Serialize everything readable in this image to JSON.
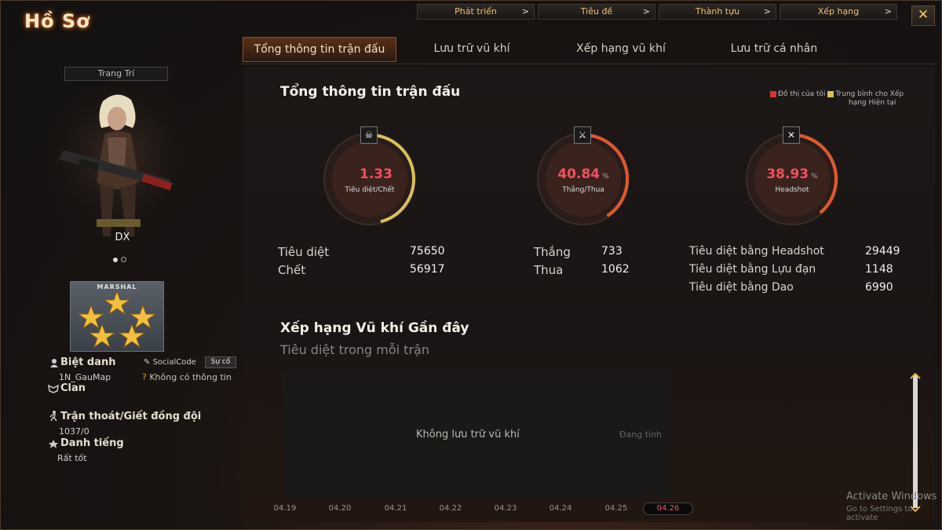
{
  "window": {
    "title": "Hồ Sơ",
    "close_icon": "close-icon"
  },
  "top_nav": [
    {
      "label": "Phát triển"
    },
    {
      "label": "Tiêu đề"
    },
    {
      "label": "Thành tựu"
    },
    {
      "label": "Xếp hạng"
    }
  ],
  "tabs": [
    {
      "label": "Tổng thông tin trận đấu",
      "active": true
    },
    {
      "label": "Lưu trữ vũ khí"
    },
    {
      "label": "Xếp hạng vũ khí"
    },
    {
      "label": "Lưu trữ cá nhân"
    }
  ],
  "profile": {
    "decoration_label": "Trang Trí",
    "character_name": "DX",
    "rank_title": "MARSHAL",
    "rank_stars": 5,
    "nickname_label": "Biệt danh",
    "nickname": "1N_GauMap",
    "socialcode_label": "SocialCode",
    "support_button": "Sự cố",
    "no_info": "Không có thông tin",
    "clan_label": "Clan",
    "escape_label": "Trận thoát/Giết đồng đội",
    "escape_value": "1037/0",
    "reputation_label": "Danh tiếng",
    "reputation_value": "Rất tốt"
  },
  "summary": {
    "title": "Tổng thông tin trận đấu",
    "legend_mine": "Đồ thị của tôi",
    "legend_avg_1": "Trung bình cho Xếp",
    "legend_avg_2": "hạng Hiện tại",
    "colors": {
      "mine": "#d03838",
      "avg": "#d8c060",
      "value": "#f25060"
    },
    "gauges": [
      {
        "value": "1.33",
        "unit": "",
        "label": "Tiêu diệt/Chết",
        "fill": 0.46,
        "icon": "skull-icon"
      },
      {
        "value": "40.84",
        "unit": "%",
        "label": "Thắng/Thua",
        "fill": 0.4084,
        "icon": "crossed-rifles-icon"
      },
      {
        "value": "38.93",
        "unit": "%",
        "label": "Headshot",
        "fill": 0.3893,
        "icon": "headshot-icon"
      }
    ],
    "stats": {
      "kills_label": "Tiêu diệt",
      "kills": "75650",
      "deaths_label": "Chết",
      "deaths": "56917",
      "wins_label": "Thắng",
      "wins": "733",
      "losses_label": "Thua",
      "losses": "1062",
      "hs_kills_label": "Tiêu diệt bằng Headshot",
      "hs_kills": "29449",
      "grenade_kills_label": "Tiêu diệt bằng Lựu đạn",
      "grenade_kills": "1148",
      "knife_kills_label": "Tiêu diệt bằng Dao",
      "knife_kills": "6990"
    }
  },
  "recent": {
    "title": "Xếp hạng Vũ khí Gần đây",
    "subtitle": "Tiêu diệt trong mỗi trận",
    "empty": "Không lưu trữ vũ khí",
    "calculating": "Đang tính",
    "dates": [
      "04.19",
      "04.20",
      "04.21",
      "04.22",
      "04.23",
      "04.24",
      "04.25",
      "04.26"
    ],
    "active_date": "04.26"
  },
  "watermark": {
    "line1": "Activate Windows",
    "line2": "Go to Settings to activate"
  }
}
